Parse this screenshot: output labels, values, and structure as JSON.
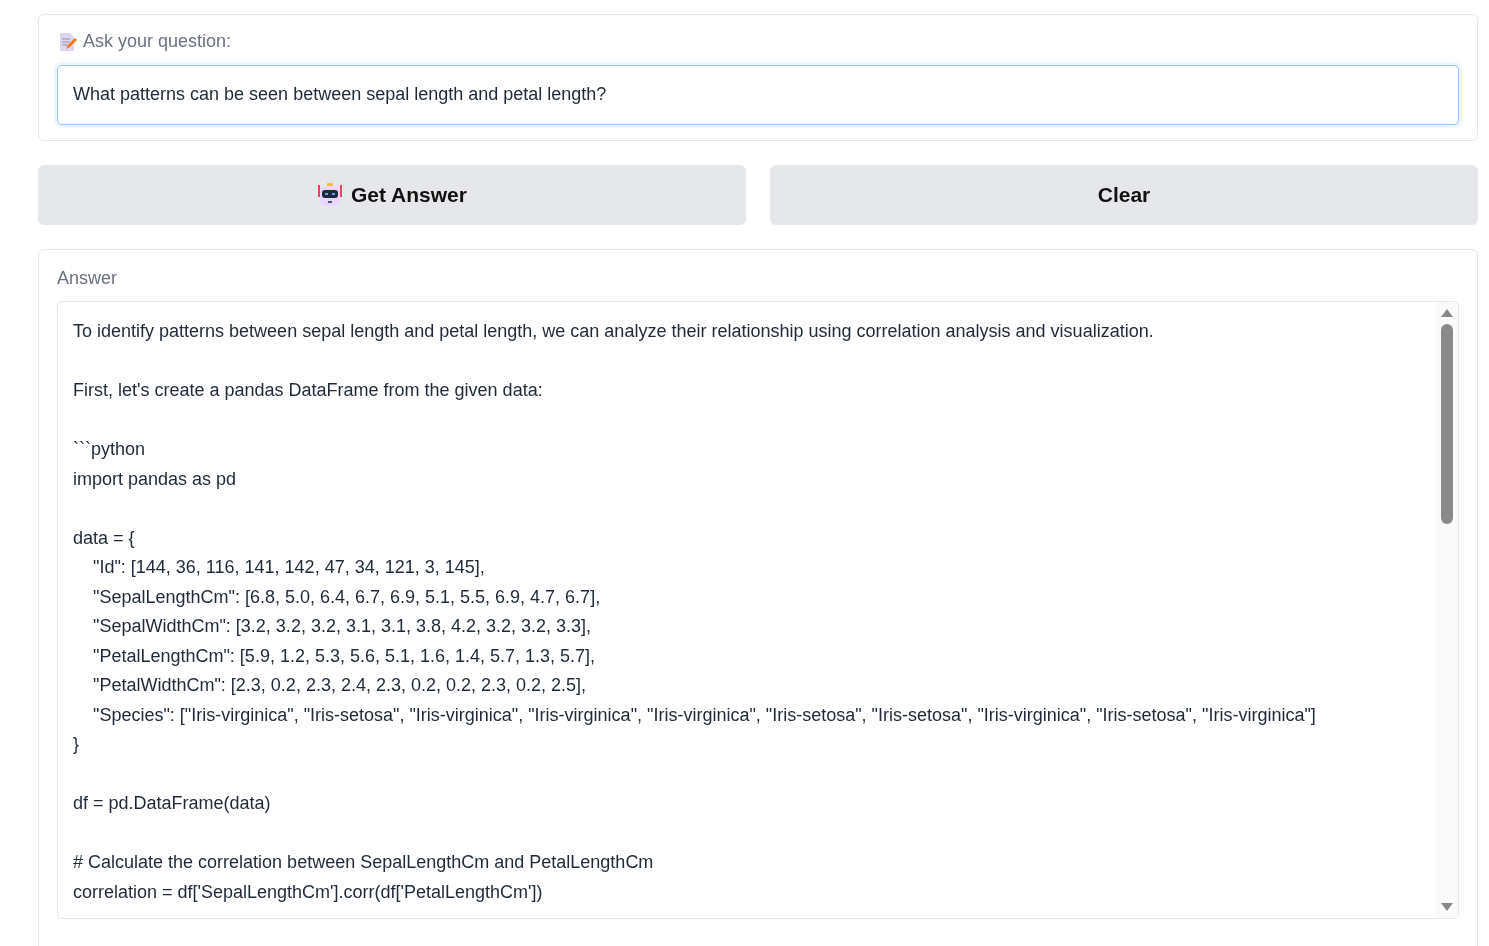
{
  "question": {
    "label": "Ask your question:",
    "value": "What patterns can be seen between sepal length and petal length?"
  },
  "buttons": [
    {
      "kind": "primary",
      "label": "Get Answer"
    },
    {
      "kind": "plain",
      "label": "Clear"
    }
  ],
  "answer": {
    "label": "Answer",
    "blocks": [
      [
        "To identify patterns between sepal length and petal length, we can analyze their relationship using correlation analysis and visualization."
      ],
      [
        "First, let's create a pandas DataFrame from the given data:"
      ],
      [
        "```python",
        "import pandas as pd"
      ],
      [
        "data = {",
        "    \"Id\": [144, 36, 116, 141, 142, 47, 34, 121, 3, 145],",
        "    \"SepalLengthCm\": [6.8, 5.0, 6.4, 6.7, 6.9, 5.1, 5.5, 6.9, 4.7, 6.7],",
        "    \"SepalWidthCm\": [3.2, 3.2, 3.2, 3.1, 3.1, 3.8, 4.2, 3.2, 3.2, 3.3],",
        "    \"PetalLengthCm\": [5.9, 1.2, 5.3, 5.6, 5.1, 1.6, 1.4, 5.7, 1.3, 5.7],",
        "    \"PetalWidthCm\": [2.3, 0.2, 2.3, 2.4, 2.3, 0.2, 0.2, 2.3, 0.2, 2.5],",
        "    \"Species\": [\"Iris-virginica\", \"Iris-setosa\", \"Iris-virginica\", \"Iris-virginica\", \"Iris-virginica\", \"Iris-setosa\", \"Iris-setosa\", \"Iris-virginica\", \"Iris-setosa\", \"Iris-virginica\"]",
        "}"
      ],
      [
        "df = pd.DataFrame(data)"
      ],
      [
        "# Calculate the correlation between SepalLengthCm and PetalLengthCm",
        "correlation = df['SepalLengthCm'].corr(df['PetalLengthCm'])"
      ]
    ]
  }
}
